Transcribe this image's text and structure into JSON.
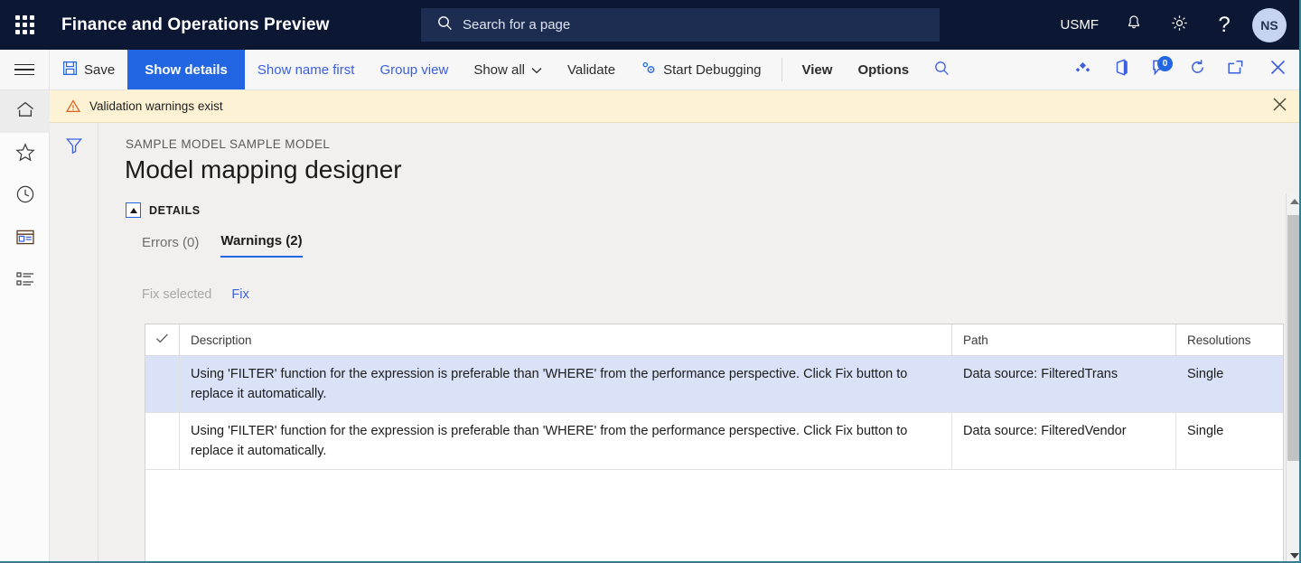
{
  "topbar": {
    "app_title": "Finance and Operations Preview",
    "waffle_icon": "app-launcher-icon",
    "search": {
      "placeholder": "Search for a page",
      "value": "",
      "icon": "search-icon"
    },
    "company": "USMF",
    "notifications_icon": "bell-icon",
    "settings_icon": "gear-icon",
    "help_icon": "question-mark-icon",
    "avatar_initials": "NS",
    "bg_color": "#0b1733",
    "search_bg_color": "#1d2d51"
  },
  "commandbar": {
    "hamburger_icon": "hamburger-menu-icon",
    "save": {
      "label": "Save",
      "icon": "save-disk-icon"
    },
    "items": [
      {
        "label": "Show details",
        "style": "active"
      },
      {
        "label": "Show name first",
        "style": "link"
      },
      {
        "label": "Group view",
        "style": "link"
      },
      {
        "label": "Show all",
        "style": "plain",
        "caret": true
      },
      {
        "label": "Validate",
        "style": "plain"
      },
      {
        "label": "Start Debugging",
        "style": "plain",
        "icon": "debug-gears-icon"
      },
      {
        "label": "View",
        "style": "bold"
      },
      {
        "label": "Options",
        "style": "bold"
      }
    ],
    "search_icon": "search-icon",
    "right_icons": [
      {
        "name": "shapes-diamond-icon"
      },
      {
        "name": "office-app-icon"
      },
      {
        "name": "chat-bubble-icon",
        "badge": "0"
      },
      {
        "name": "refresh-icon"
      },
      {
        "name": "open-in-new-window-icon"
      },
      {
        "name": "close-icon"
      }
    ],
    "active_bg_color": "#2266e3",
    "link_color": "#3b5fe0"
  },
  "messagebar": {
    "icon": "warning-triangle-icon",
    "text": "Validation warnings exist",
    "close_icon": "close-icon",
    "bg_color": "#fdf3d4"
  },
  "rail": {
    "items": [
      {
        "name": "sidebar-item-home",
        "icon": "home-icon",
        "selected": true
      },
      {
        "name": "sidebar-item-favorites",
        "icon": "star-icon",
        "selected": false
      },
      {
        "name": "sidebar-item-recent",
        "icon": "clock-icon",
        "selected": false
      },
      {
        "name": "sidebar-item-workspaces",
        "icon": "workspace-icon",
        "selected": false
      },
      {
        "name": "sidebar-item-modules",
        "icon": "list-icon",
        "selected": false
      }
    ]
  },
  "filterpane": {
    "icon": "filter-funnel-icon"
  },
  "page": {
    "breadcrumb": "SAMPLE MODEL SAMPLE MODEL",
    "title": "Model mapping designer",
    "details_section": {
      "label": "DETAILS",
      "collapse_icon": "collapse-caret-icon",
      "expanded": true
    },
    "tabs": [
      {
        "label": "Errors (0)",
        "selected": false
      },
      {
        "label": "Warnings (2)",
        "selected": true
      }
    ],
    "actions": [
      {
        "label": "Fix selected",
        "enabled": false
      },
      {
        "label": "Fix",
        "enabled": true
      }
    ]
  },
  "grid": {
    "columns": [
      {
        "key": "check",
        "label": "",
        "icon": "checkmark-icon"
      },
      {
        "key": "description",
        "label": "Description"
      },
      {
        "key": "path",
        "label": "Path"
      },
      {
        "key": "resolutions",
        "label": "Resolutions"
      }
    ],
    "rows": [
      {
        "description": "Using 'FILTER' function for the expression is preferable than 'WHERE' from the performance perspective. Click Fix button to replace it automatically.",
        "path": "Data source: FilteredTrans",
        "resolutions": "Single",
        "selected": true
      },
      {
        "description": "Using 'FILTER' function for the expression is preferable than 'WHERE' from the performance perspective. Click Fix button to replace it automatically.",
        "path": "Data source: FilteredVendor",
        "resolutions": "Single",
        "selected": false
      }
    ],
    "selected_row_color": "#d9e2f7"
  },
  "scrollbar": {
    "up_arrow_icon": "caret-up-icon",
    "down_arrow_icon": "caret-down-icon",
    "thumb": "scroll-thumb"
  }
}
